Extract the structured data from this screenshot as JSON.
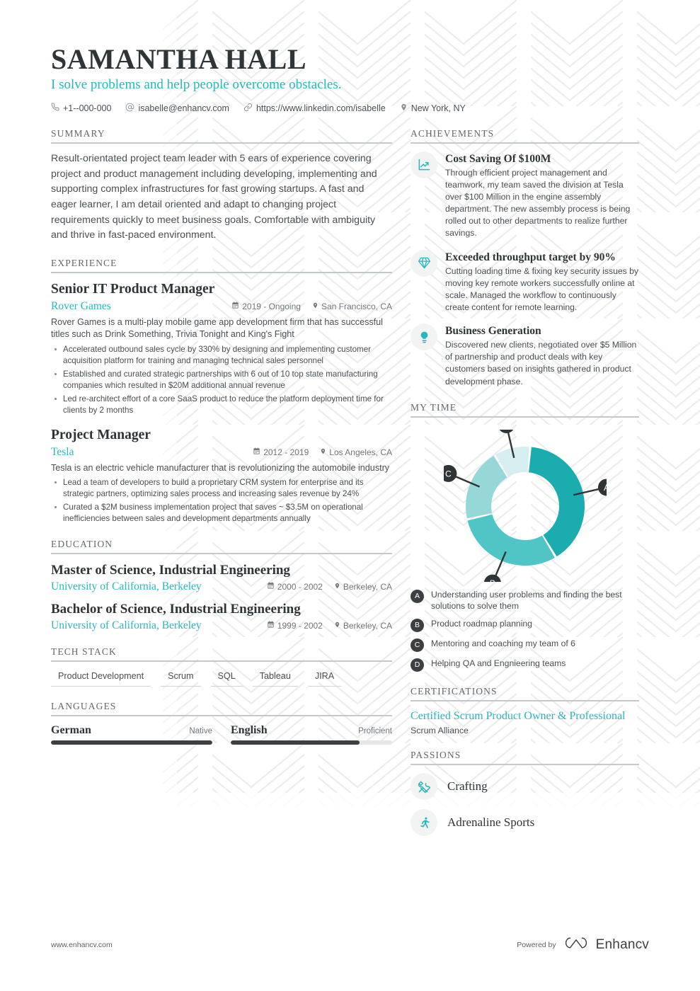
{
  "header": {
    "name": "SAMANTHA HALL",
    "tagline": "I solve problems and help people overcome obstacles.",
    "contacts": [
      {
        "icon": "phone-icon",
        "text": "+1--000-000"
      },
      {
        "icon": "at-sign-icon",
        "text": "isabelle@enhancv.com"
      },
      {
        "icon": "link-icon",
        "text": "https://www.linkedin.com/isabelle"
      },
      {
        "icon": "location-pin-icon",
        "text": "New York, NY"
      }
    ]
  },
  "summary": {
    "heading": "SUMMARY",
    "text": "Result-orientated project team leader with 5 ears of experience covering project and product management including developing, implementing and supporting complex infrastructures for fast growing startups. A fast and eager learner, I am detail oriented and adapt to changing project requirements quickly to meet business goals. Comfortable with ambiguity and thrive in fast-paced environment."
  },
  "experience": {
    "heading": "EXPERIENCE",
    "entries": [
      {
        "title": "Senior IT Product Manager",
        "org": "Rover Games",
        "dates": "2019 - Ongoing",
        "location": "San Francisco, CA",
        "desc": "Rover Games is a multi-play mobile game app development firm that has successful titles such as Drink Something, Trivia Tonight and King's Fight",
        "bullets": [
          "Accelerated outbound sales cycle by 330% by designing and implementing customer acquisition platform for training and managing technical sales personnel",
          "Established and curated strategic partnerships with 6 out of 10 top state manufacturing companies which resulted in $20M additional annual revenue",
          "Led re-architect effort of a core SaaS product to reduce the platform deployment time for clients by 2 months"
        ]
      },
      {
        "title": "Project Manager",
        "org": "Tesla",
        "dates": "2012 - 2019",
        "location": "Los Angeles, CA",
        "desc": "Tesla is an electric vehicle manufacturer that is revolutionizing the automobile industry",
        "bullets": [
          "Lead a team of developers to build a proprietary CRM system for enterprise and its strategic partners, optimizing sales process and increasing sales revenue by 24%",
          "Curated a $2M business implementation project that saves ~ $3.5M on operational inefficiencies between sales and development departments annually"
        ]
      }
    ]
  },
  "education": {
    "heading": "EDUCATION",
    "entries": [
      {
        "title": "Master of Science, Industrial Engineering",
        "org": "University of California, Berkeley",
        "dates": "2000 - 2002",
        "location": "Berkeley, CA"
      },
      {
        "title": "Bachelor of Science, Industrial Engineering",
        "org": "University of California, Berkeley",
        "dates": "1999 - 2002",
        "location": "Berkeley, CA"
      }
    ]
  },
  "tech_stack": {
    "heading": "TECH STACK",
    "items": [
      "Product Development",
      "Scrum",
      "SQL",
      "Tableau",
      "JIRA"
    ]
  },
  "languages": {
    "heading": "LANGUAGES",
    "items": [
      {
        "name": "German",
        "level": "Native",
        "fill_pct": 100
      },
      {
        "name": "English",
        "level": "Proficient",
        "fill_pct": 80
      }
    ]
  },
  "achievements": {
    "heading": "ACHIEVEMENTS",
    "items": [
      {
        "icon": "trending-chart-icon",
        "title": "Cost Saving Of $100M",
        "text": "Through efficient project management and teamwork, my team saved the division at Tesla over $100 Million in the engine assembly department. The new assembly process is being rolled out to other departments to realize further savings."
      },
      {
        "icon": "diamond-icon",
        "title": "Exceeded throughput target by 90%",
        "text": "Cutting loading time & fixing key security issues by moving key remote workers successfully online at scale. Managed the workflow to continuously create content for remote learning."
      },
      {
        "icon": "lightbulb-icon",
        "title": "Business Generation",
        "text": "Discovered new clients, negotiated over $5 Million of partnership and product deals with key customers based on insights gathered in product development phase."
      }
    ]
  },
  "my_time": {
    "heading": "MY TIME"
  },
  "chart_data": {
    "type": "pie",
    "title": "MY TIME",
    "subtype": "donut",
    "categories": [
      "A",
      "B",
      "C",
      "D"
    ],
    "values": [
      40,
      30,
      20,
      10
    ],
    "labels": [
      "Understanding user problems and finding the best solutions to solve them",
      "Product roadmap planning",
      "Mentoring and coaching my team of 6",
      "Helping QA and Engnieering teams"
    ],
    "colors": [
      "#1BACB0",
      "#4FC5C5",
      "#96D8D8",
      "#D6EEEF"
    ],
    "legend_position": "bottom",
    "start_angle": 5,
    "units": "percent"
  },
  "certifications": {
    "heading": "CERTIFICATIONS",
    "items": [
      {
        "name": "Certified Scrum Product Owner & Professional",
        "org": "Scrum Alliance"
      }
    ]
  },
  "passions": {
    "heading": "PASSIONS",
    "items": [
      {
        "icon": "tools-icon",
        "label": "Crafting"
      },
      {
        "icon": "runner-icon",
        "label": "Adrenaline Sports"
      }
    ]
  },
  "footer": {
    "url": "www.enhancv.com",
    "powered_by": "Powered by",
    "brand": "Enhancv"
  },
  "colors": {
    "accent_teal": "#2ab6bd",
    "dark_text": "#2f3437",
    "body_text": "#4a4f54",
    "rule": "#c6c9cb"
  }
}
